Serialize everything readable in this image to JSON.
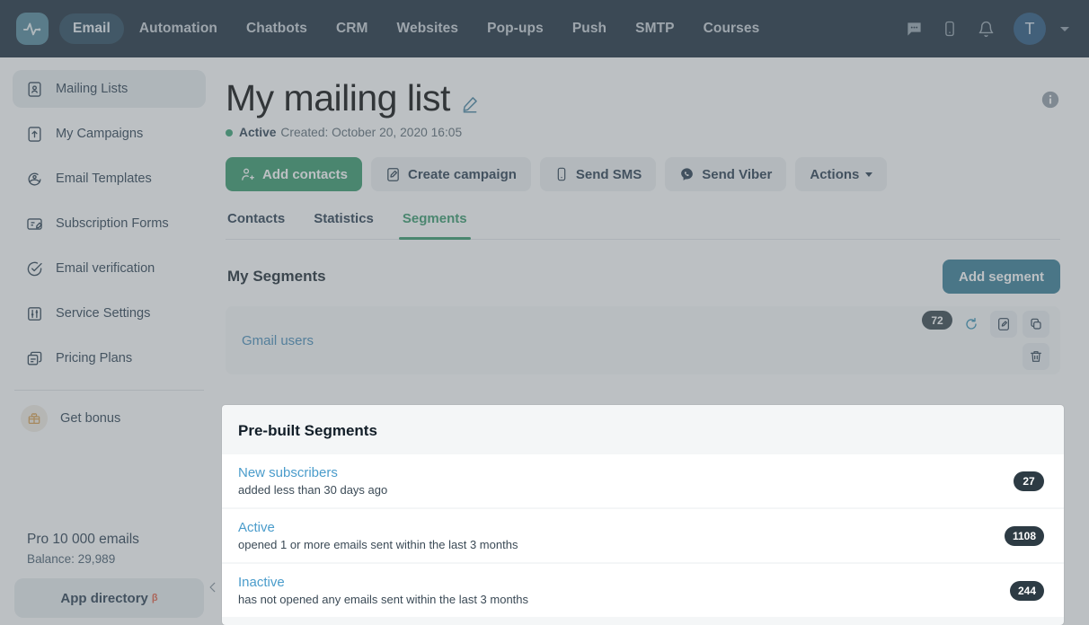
{
  "topnav": {
    "logo_icon": "activity-pulse-icon",
    "links": [
      {
        "label": "Email",
        "active": true
      },
      {
        "label": "Automation",
        "active": false
      },
      {
        "label": "Chatbots",
        "active": false
      },
      {
        "label": "CRM",
        "active": false
      },
      {
        "label": "Websites",
        "active": false
      },
      {
        "label": "Pop-ups",
        "active": false
      },
      {
        "label": "Push",
        "active": false
      },
      {
        "label": "SMTP",
        "active": false
      },
      {
        "label": "Courses",
        "active": false
      }
    ],
    "icons": [
      "chat-bubble-icon",
      "mobile-phone-icon",
      "bell-icon"
    ],
    "avatar_initial": "T"
  },
  "sidebar": {
    "items": [
      {
        "label": "Mailing Lists",
        "icon": "contact-card-icon",
        "active": true
      },
      {
        "label": "My Campaigns",
        "icon": "upload-box-icon",
        "active": false
      },
      {
        "label": "Email Templates",
        "icon": "template-icon",
        "active": false
      },
      {
        "label": "Subscription Forms",
        "icon": "form-edit-icon",
        "active": false
      },
      {
        "label": "Email verification",
        "icon": "check-circle-icon",
        "active": false
      },
      {
        "label": "Service Settings",
        "icon": "sliders-icon",
        "active": false
      },
      {
        "label": "Pricing Plans",
        "icon": "stacked-cards-icon",
        "active": false
      }
    ],
    "bonus": {
      "label": "Get bonus",
      "icon": "gift-icon"
    },
    "plan": {
      "title": "Pro 10 000 emails",
      "balance": "Balance: 29,989"
    },
    "app_directory": {
      "label": "App directory",
      "badge": "β"
    },
    "collapse_icon": "chevron-left-icon"
  },
  "main": {
    "title": "My mailing list",
    "edit_icon": "pencil-icon",
    "info_icon": "info-circle-icon",
    "status": "Active",
    "created": "Created: October 20, 2020 16:05",
    "buttons": [
      {
        "label": "Add contacts",
        "icon": "add-user-icon",
        "primary": true
      },
      {
        "label": "Create campaign",
        "icon": "campaign-icon",
        "primary": false
      },
      {
        "label": "Send SMS",
        "icon": "mobile-phone-icon",
        "primary": false
      },
      {
        "label": "Send Viber",
        "icon": "viber-icon",
        "primary": false
      },
      {
        "label": "Actions",
        "icon": "chevron-down-icon",
        "primary": false
      }
    ],
    "tabs": [
      {
        "label": "Contacts",
        "active": false
      },
      {
        "label": "Statistics",
        "active": false
      },
      {
        "label": "Segments",
        "active": true
      }
    ],
    "my_segments": {
      "title": "My Segments",
      "add_button": "Add segment",
      "rows": [
        {
          "name": "Gmail users",
          "count": "72",
          "tools": [
            "refresh-icon",
            "edit-icon",
            "copy-icon",
            "trash-icon"
          ]
        }
      ]
    },
    "prebuilt": {
      "title": "Pre-built Segments",
      "rows": [
        {
          "name": "New subscribers",
          "desc": "added less than 30 days ago",
          "count": "27"
        },
        {
          "name": "Active",
          "desc": "opened 1 or more emails sent within the last 3 months",
          "count": "1108"
        },
        {
          "name": "Inactive",
          "desc": "has not opened any emails sent within the last 3 months",
          "count": "244"
        }
      ]
    }
  },
  "colors": {
    "navbar_bg": "#122434",
    "accent_green": "#2e9464",
    "accent_teal": "#2d7690",
    "link_blue": "#4a9ccb",
    "badge_dark": "#2d3b44",
    "beta_orange": "#e2573c"
  }
}
